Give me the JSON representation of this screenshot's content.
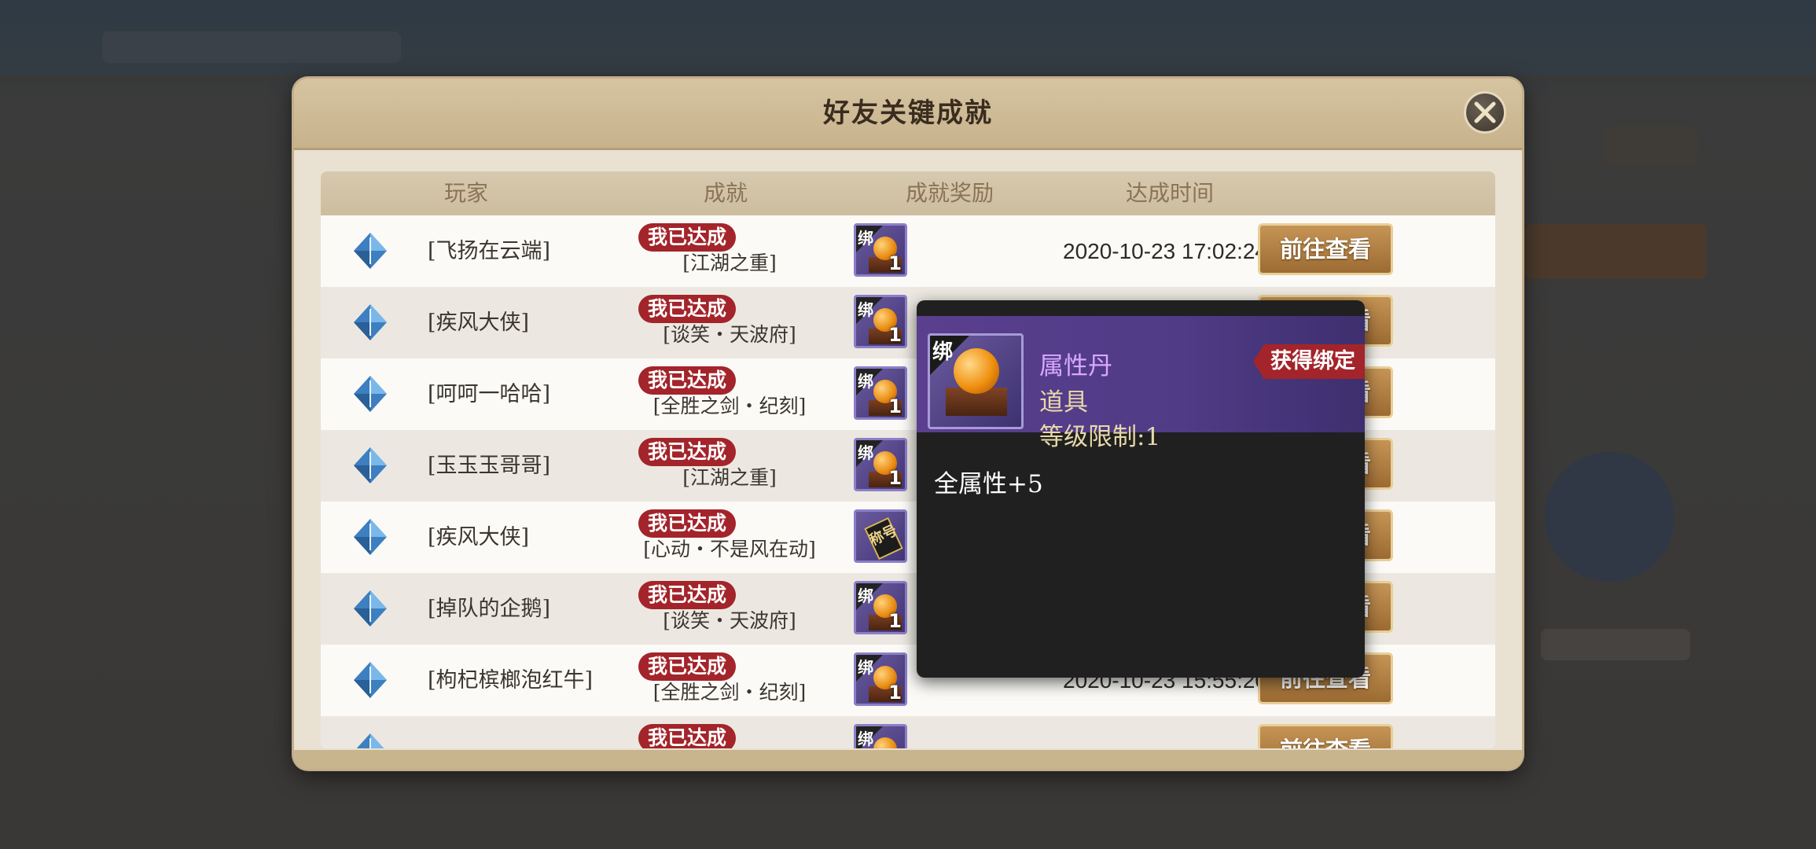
{
  "dialog": {
    "title": "好友关键成就"
  },
  "columns": {
    "player": "玩家",
    "achievement": "成就",
    "reward": "成就奖励",
    "time": "达成时间"
  },
  "bind_label": "绑",
  "rows": [
    {
      "player": "[飞扬在云端]",
      "badge": "我已达成",
      "achievement": "[江湖之重]",
      "reward_type": "pill",
      "qty": "1",
      "time": "2020-10-23 17:02:24",
      "button": "前往查看"
    },
    {
      "player": "[疾风大侠]",
      "badge": "我已达成",
      "achievement": "[谈笑・天波府]",
      "reward_type": "pill",
      "qty": "1",
      "time": "",
      "button": "前往查看"
    },
    {
      "player": "[呵呵一哈哈]",
      "badge": "我已达成",
      "achievement": "[全胜之剑・纪刻]",
      "reward_type": "pill",
      "qty": "1",
      "time": "",
      "button": "前往查看"
    },
    {
      "player": "[玉玉玉哥哥]",
      "badge": "我已达成",
      "achievement": "[江湖之重]",
      "reward_type": "pill",
      "qty": "1",
      "time": "",
      "button": "前往查看"
    },
    {
      "player": "[疾风大侠]",
      "badge": "我已达成",
      "achievement": "[心动・不是风在动]",
      "reward_type": "scroll",
      "scroll_text": "称号",
      "qty": "",
      "time": "",
      "button": "前往查看"
    },
    {
      "player": "[掉队的企鹅]",
      "badge": "我已达成",
      "achievement": "[谈笑・天波府]",
      "reward_type": "pill",
      "qty": "1",
      "time": "",
      "button": "前往查看"
    },
    {
      "player": "[枸杞槟榔泡红牛]",
      "badge": "我已达成",
      "achievement": "[全胜之剑・纪刻]",
      "reward_type": "pill",
      "qty": "1",
      "time": "2020-10-23 15:55:20",
      "button": "前往查看"
    },
    {
      "player": "",
      "badge": "我已达成",
      "achievement": "",
      "reward_type": "pill",
      "qty": "",
      "time": "",
      "button": "前往查看"
    }
  ],
  "tooltip": {
    "item_name": "属性丹",
    "item_type": "道具",
    "level_limit": "等级限制:1",
    "bind_status": "获得绑定",
    "attribute": "全属性+5",
    "name_color": "#d9a8ff"
  },
  "colors": {
    "badge_red": "#a3242a",
    "button_brown": "#9c6b33",
    "header_tan": "#c7b28c"
  }
}
